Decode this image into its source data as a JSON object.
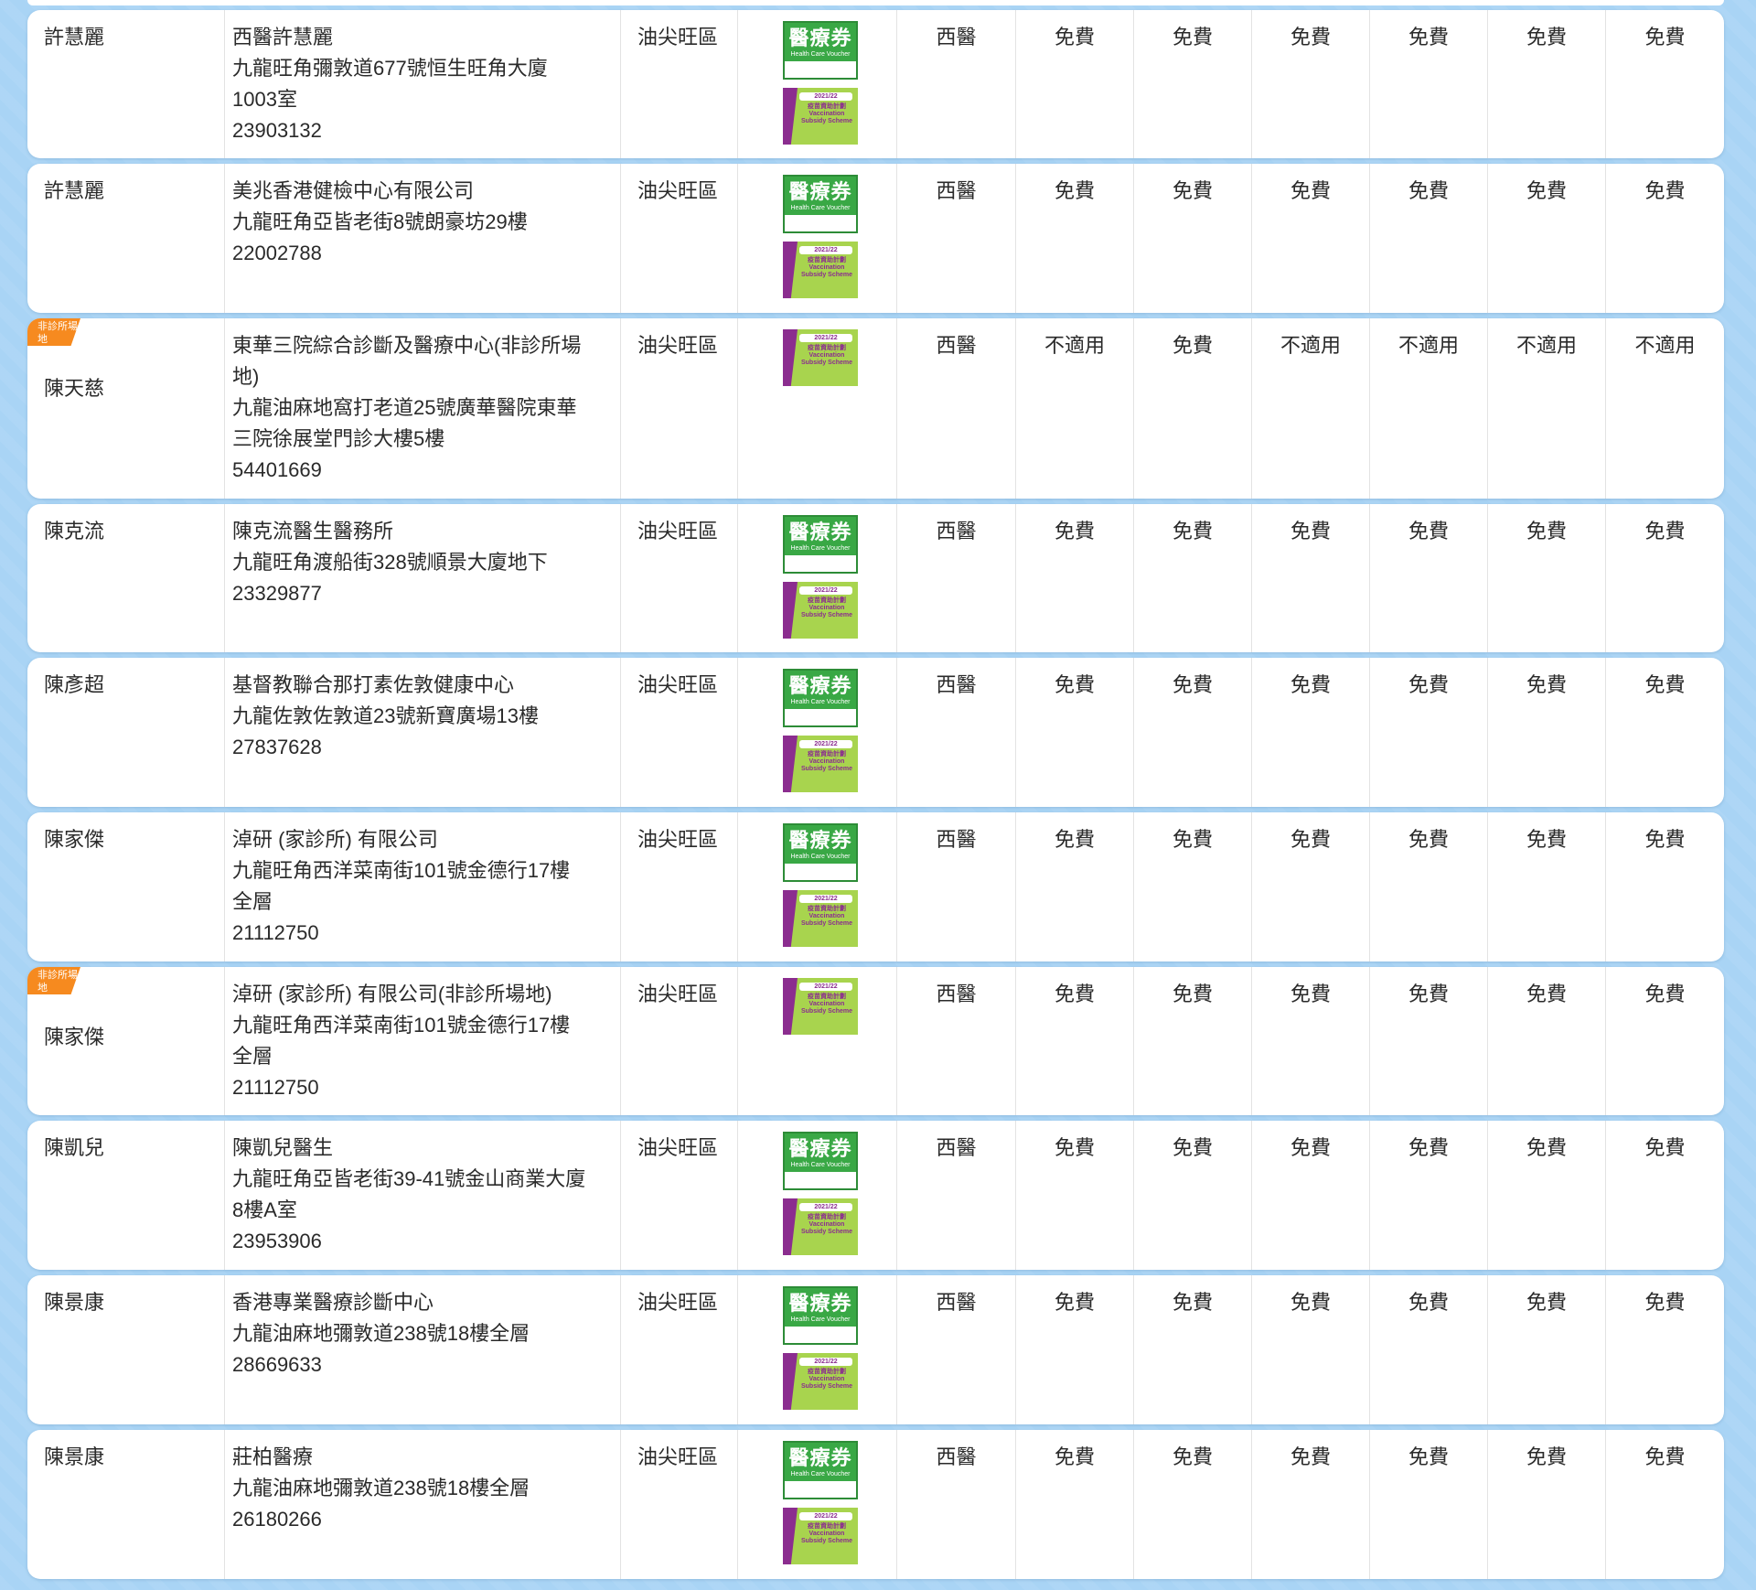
{
  "logos": {
    "hcv_title": "醫療券",
    "hcv_subtitle": "Health Care Voucher",
    "vss_year": "2021/22",
    "vss_title": "疫苗資助計劃",
    "vss_en": "Vaccination Subsidy Scheme"
  },
  "colors": {
    "page_background": "#a9d4f5",
    "nonclinic_tag": "#f68a1f",
    "hcv_green": "#39a845",
    "vss_green": "#a8d44e",
    "vss_purple": "#8b2d8f"
  },
  "rows": [
    {
      "doctor": "許慧麗",
      "nonclinic_tag": "",
      "clinic_name": "西醫許慧麗",
      "address1": "九龍旺角彌敦道677號恒生旺角大廈",
      "address2": "1003室",
      "phone": "23903132",
      "district": "油尖旺區",
      "has_hcv": true,
      "has_vss": true,
      "type": "西醫",
      "fees": [
        "免費",
        "免費",
        "免費",
        "免費",
        "免費",
        "免費"
      ]
    },
    {
      "doctor": "許慧麗",
      "nonclinic_tag": "",
      "clinic_name": "美兆香港健檢中心有限公司",
      "address1": "九龍旺角亞皆老街8號朗豪坊29樓",
      "address2": "",
      "phone": "22002788",
      "district": "油尖旺區",
      "has_hcv": true,
      "has_vss": true,
      "type": "西醫",
      "fees": [
        "免費",
        "免費",
        "免費",
        "免費",
        "免費",
        "免費"
      ]
    },
    {
      "doctor": "陳天慈",
      "nonclinic_tag": "非診所場地",
      "clinic_name": "東華三院綜合診斷及醫療中心(非診所場",
      "address1": "地)",
      "address2": "九龍油麻地窩打老道25號廣華醫院東華",
      "address3": "三院徐展堂門診大樓5樓",
      "phone": "54401669",
      "district": "油尖旺區",
      "has_hcv": false,
      "has_vss": true,
      "type": "西醫",
      "fees": [
        "不適用",
        "免費",
        "不適用",
        "不適用",
        "不適用",
        "不適用"
      ]
    },
    {
      "doctor": "陳克流",
      "nonclinic_tag": "",
      "clinic_name": "陳克流醫生醫務所",
      "address1": "九龍旺角渡船街328號順景大廈地下",
      "address2": "",
      "phone": "23329877",
      "district": "油尖旺區",
      "has_hcv": true,
      "has_vss": true,
      "type": "西醫",
      "fees": [
        "免費",
        "免費",
        "免費",
        "免費",
        "免費",
        "免費"
      ]
    },
    {
      "doctor": "陳彥超",
      "nonclinic_tag": "",
      "clinic_name": "基督教聯合那打素佐敦健康中心",
      "address1": "九龍佐敦佐敦道23號新寶廣場13樓",
      "address2": "",
      "phone": "27837628",
      "district": "油尖旺區",
      "has_hcv": true,
      "has_vss": true,
      "type": "西醫",
      "fees": [
        "免費",
        "免費",
        "免費",
        "免費",
        "免費",
        "免費"
      ]
    },
    {
      "doctor": "陳家傑",
      "nonclinic_tag": "",
      "clinic_name": "淖研 (家診所) 有限公司",
      "address1": "九龍旺角西洋菜南街101號金德行17樓",
      "address2": "全層",
      "phone": "21112750",
      "district": "油尖旺區",
      "has_hcv": true,
      "has_vss": true,
      "type": "西醫",
      "fees": [
        "免費",
        "免費",
        "免費",
        "免費",
        "免費",
        "免費"
      ]
    },
    {
      "doctor": "陳家傑",
      "nonclinic_tag": "非診所場地",
      "clinic_name": "淖研 (家診所) 有限公司(非診所場地)",
      "address1": "九龍旺角西洋菜南街101號金德行17樓",
      "address2": "全層",
      "phone": "21112750",
      "district": "油尖旺區",
      "has_hcv": false,
      "has_vss": true,
      "type": "西醫",
      "fees": [
        "免費",
        "免費",
        "免費",
        "免費",
        "免費",
        "免費"
      ]
    },
    {
      "doctor": "陳凱兒",
      "nonclinic_tag": "",
      "clinic_name": "陳凱兒醫生",
      "address1": "九龍旺角亞皆老街39-41號金山商業大廈",
      "address2": "8樓A室",
      "phone": "23953906",
      "district": "油尖旺區",
      "has_hcv": true,
      "has_vss": true,
      "type": "西醫",
      "fees": [
        "免費",
        "免費",
        "免費",
        "免費",
        "免費",
        "免費"
      ]
    },
    {
      "doctor": "陳景康",
      "nonclinic_tag": "",
      "clinic_name": "香港專業醫療診斷中心",
      "address1": "九龍油麻地彌敦道238號18樓全層",
      "address2": "",
      "phone": "28669633",
      "district": "油尖旺區",
      "has_hcv": true,
      "has_vss": true,
      "type": "西醫",
      "fees": [
        "免費",
        "免費",
        "免費",
        "免費",
        "免費",
        "免費"
      ]
    },
    {
      "doctor": "陳景康",
      "nonclinic_tag": "",
      "clinic_name": "莊柏醫療",
      "address1": "九龍油麻地彌敦道238號18樓全層",
      "address2": "",
      "phone": "26180266",
      "district": "油尖旺區",
      "has_hcv": true,
      "has_vss": true,
      "type": "西醫",
      "fees": [
        "免費",
        "免費",
        "免費",
        "免費",
        "免費",
        "免費"
      ]
    }
  ]
}
